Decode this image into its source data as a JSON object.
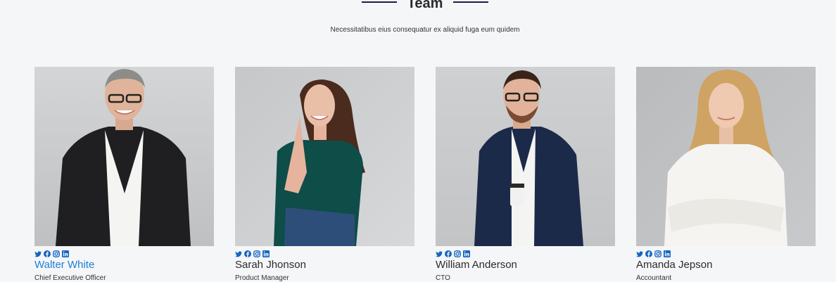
{
  "section": {
    "title": "Team",
    "subtitle": "Necessitatibus eius consequatur ex aliquid fuga eum quidem"
  },
  "team": [
    {
      "name": "Walter White",
      "role": "Chief Executive Officer",
      "active": true
    },
    {
      "name": "Sarah Jhonson",
      "role": "Product Manager",
      "active": false
    },
    {
      "name": "William Anderson",
      "role": "CTO",
      "active": false
    },
    {
      "name": "Amanda Jepson",
      "role": "Accountant",
      "active": false
    }
  ],
  "colors": {
    "accent": "#1e7ed6",
    "rule": "#1a1c4a",
    "social": "#1565c0"
  },
  "icons": [
    "twitter-icon",
    "facebook-icon",
    "instagram-icon",
    "linkedin-icon"
  ]
}
